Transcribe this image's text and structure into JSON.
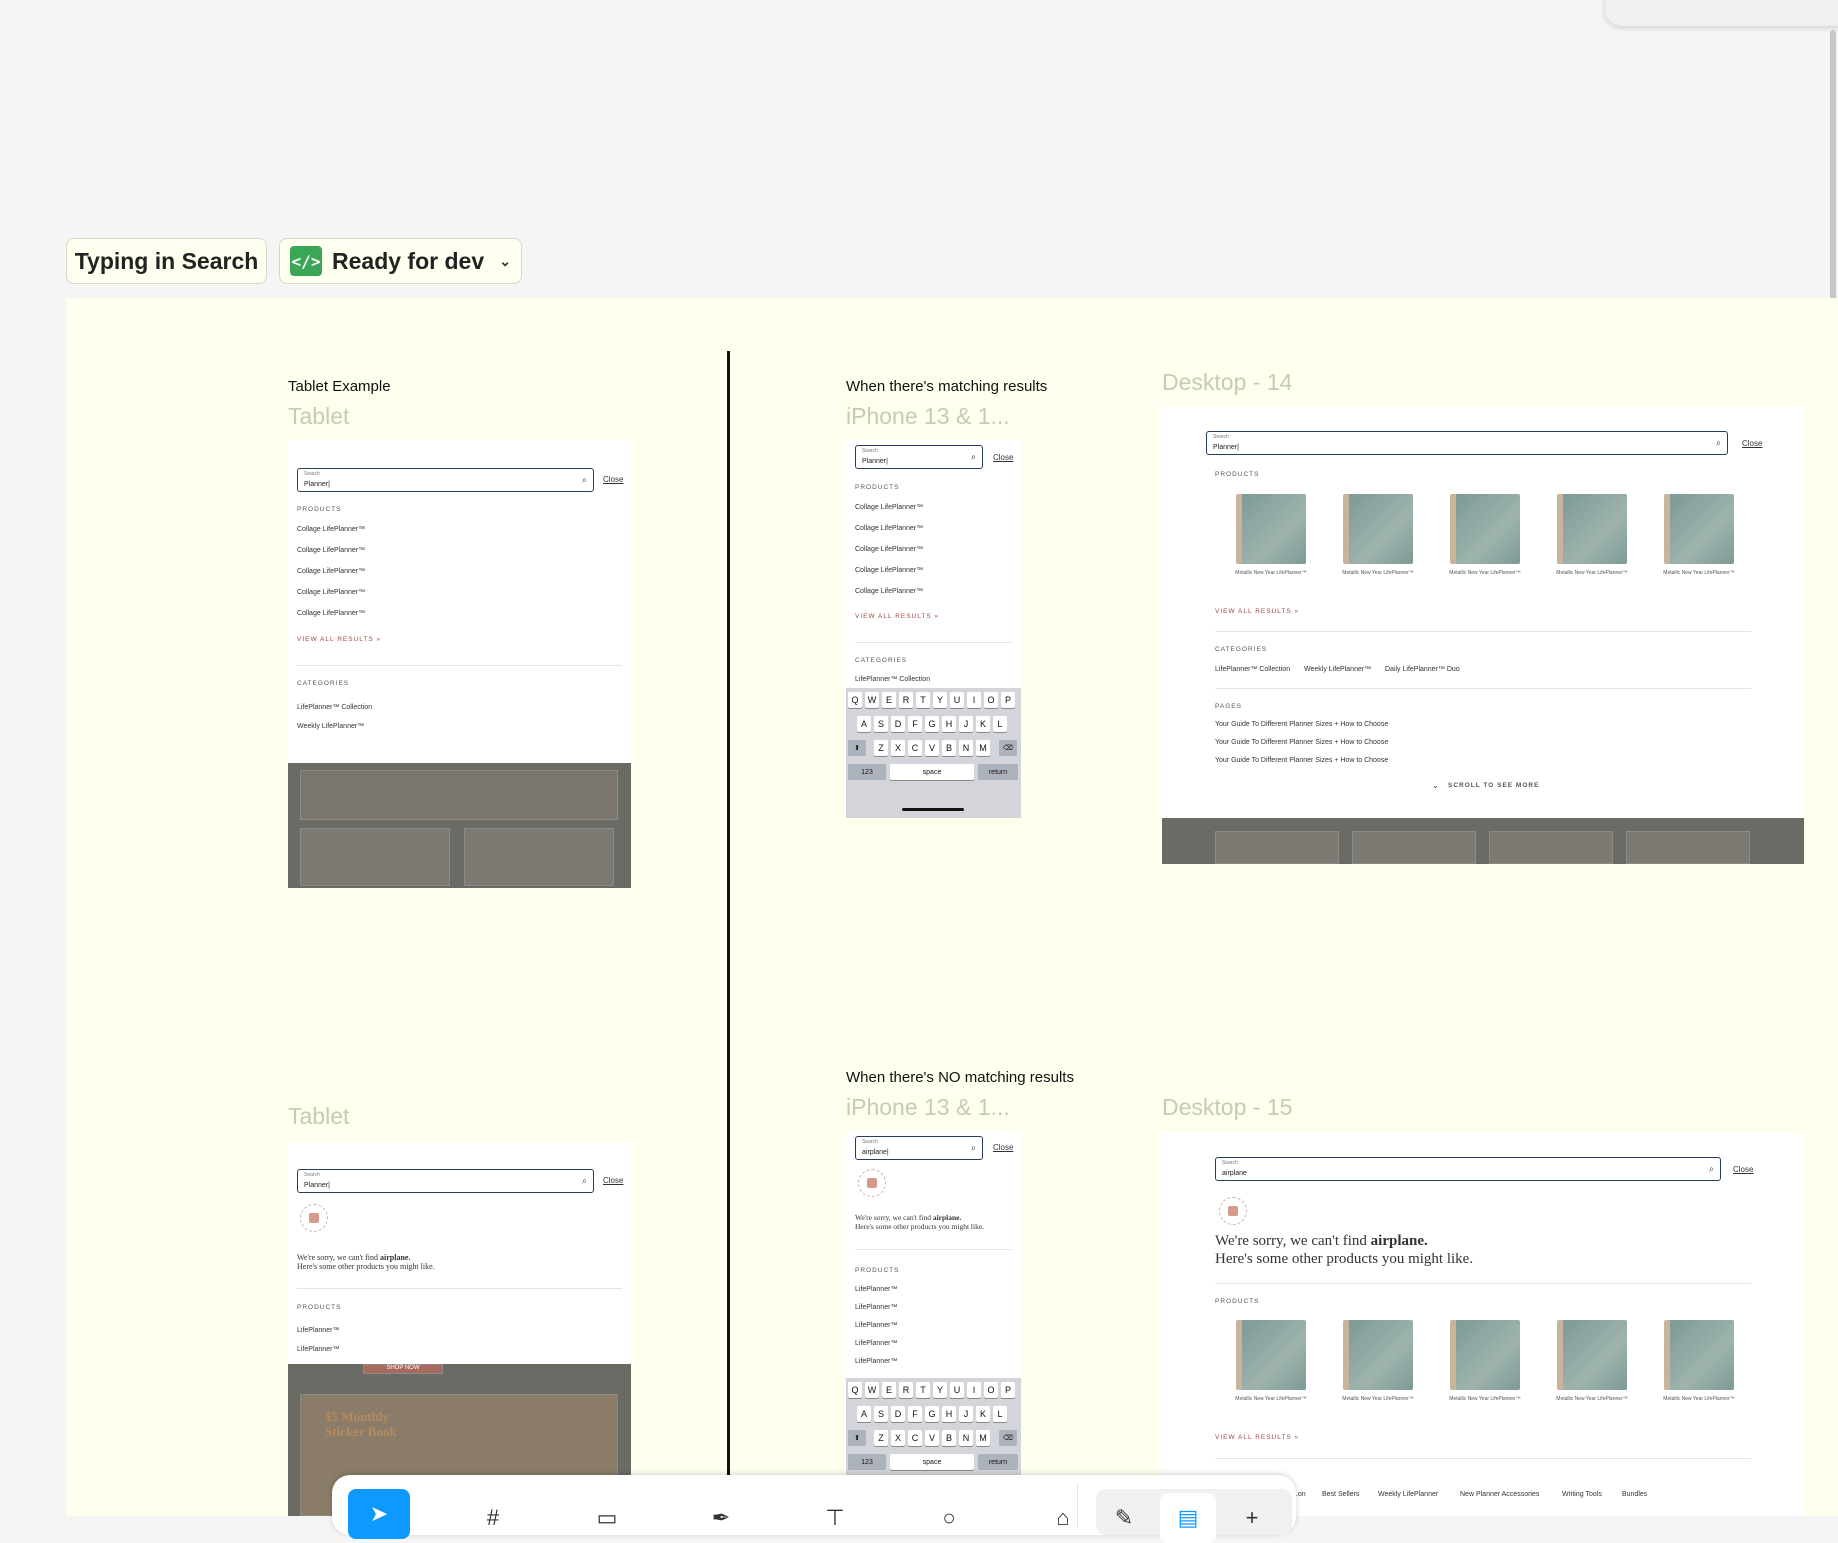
{
  "header": {
    "section_label": "Typing in Search",
    "status_label": "Ready for dev",
    "status_icon": "code-icon",
    "status_color": "#3aa757"
  },
  "frames": {
    "tablet_example": {
      "title": "Tablet Example",
      "label": "Tablet",
      "search_label": "Search",
      "search_value": "Planner|",
      "close": "Close",
      "products_heading": "PRODUCTS",
      "products": [
        "Collage LifePlanner™",
        "Collage LifePlanner™",
        "Collage LifePlanner™",
        "Collage LifePlanner™",
        "Collage LifePlanner™"
      ],
      "view_all": "VIEW ALL RESULTS »",
      "categories_heading": "CATEGORIES",
      "categories": [
        "LifePlanner™ Collection",
        "Weekly LifePlanner™"
      ]
    },
    "iphone_matching": {
      "title": "When there's matching results",
      "label": "iPhone 13 & 1...",
      "search_label": "Search",
      "search_value": "Planner|",
      "close": "Close",
      "products_heading": "PRODUCTS",
      "products": [
        "Collage LifePlanner™",
        "Collage LifePlanner™",
        "Collage LifePlanner™",
        "Collage LifePlanner™",
        "Collage LifePlanner™"
      ],
      "view_all": "VIEW ALL RESULTS »",
      "categories_heading": "CATEGORIES",
      "categories": [
        "LifePlanner™ Collection"
      ]
    },
    "desktop_14": {
      "label": "Desktop - 14",
      "search_label": "Search",
      "search_value": "Planner|",
      "close": "Close",
      "products_heading": "PRODUCTS",
      "product_captions": [
        "Metallic New Year LifePlanner™",
        "Metallic New Year LifePlanner™",
        "Metallic New Year LifePlanner™",
        "Metallic New Year LifePlanner™",
        "Metallic New Year LifePlanner™"
      ],
      "view_all": "VIEW ALL RESULTS »",
      "categories_heading": "CATEGORIES",
      "categories": [
        "LifePlanner™ Collection",
        "Weekly LifePlanner™",
        "Daily LifePlanner™ Duo"
      ],
      "pages_heading": "PAGES",
      "pages": [
        "Your Guide To Different Planner Sizes + How to Choose",
        "Your Guide To Different Planner Sizes + How to Choose",
        "Your Guide To Different Planner Sizes + How to Choose"
      ],
      "scroll_more": "SCROLL TO SEE MORE"
    },
    "tablet_no_match": {
      "label": "Tablet",
      "search_label": "Search",
      "search_value": "Planner|",
      "close": "Close",
      "sorry_line1_pre": "We're sorry, we can't find ",
      "sorry_term": "airplane.",
      "sorry_line2": "Here's some other products you might like.",
      "products_heading": "PRODUCTS",
      "products": [
        "LifePlanner™",
        "LifePlanner™"
      ],
      "promo_shop": "SHOP NOW",
      "promo_title": "$5 Monthly Sticker Book"
    },
    "iphone_no_match": {
      "title": "When there's NO matching results",
      "label": "iPhone 13 & 1...",
      "search_label": "Search",
      "search_value": "airplane|",
      "close": "Close",
      "sorry_line1_pre": "We're sorry, we can't find ",
      "sorry_term": "airplane.",
      "sorry_line2": "Here's some other products you might like.",
      "products_heading": "PRODUCTS",
      "products": [
        "LifePlanner™",
        "LifePlanner™",
        "LifePlanner™",
        "LifePlanner™",
        "LifePlanner™"
      ]
    },
    "desktop_15": {
      "label": "Desktop - 15",
      "search_label": "Search",
      "search_value": "airplane",
      "close": "Close",
      "sorry_line1_pre": "We're sorry, we can't find ",
      "sorry_term": "airplane.",
      "sorry_line2": "Here's some other products you might like.",
      "products_heading": "PRODUCTS",
      "product_captions": [
        "Metallic New Year LifePlanner™",
        "Metallic New Year LifePlanner™",
        "Metallic New Year LifePlanner™",
        "Metallic New Year LifePlanner™",
        "Metallic New Year LifePlanner™"
      ],
      "view_all": "VIEW ALL RESULTS »",
      "nav_links": [
        "...on",
        "Best Sellers",
        "Weekly LifePlanner",
        "New Planner Accessories",
        "Writing Tools",
        "Bundles"
      ]
    }
  },
  "keyboard": {
    "row1": [
      "Q",
      "W",
      "E",
      "R",
      "T",
      "Y",
      "U",
      "I",
      "O",
      "P"
    ],
    "row2": [
      "A",
      "S",
      "D",
      "F",
      "G",
      "H",
      "J",
      "K",
      "L"
    ],
    "row3": [
      "Z",
      "X",
      "C",
      "V",
      "B",
      "N",
      "M"
    ],
    "shift": "⬆",
    "delete": "⌫",
    "num": "123",
    "space": "space",
    "return": "return"
  },
  "toolbar": {
    "tools": [
      "move-tool-icon",
      "frame-tool-icon",
      "rectangle-tool-icon",
      "pen-tool-icon",
      "text-tool-icon",
      "comment-tool-icon",
      "shapes-tool-icon"
    ],
    "mode_tools": [
      "draw-mode-icon",
      "design-mode-icon",
      "more-icon"
    ]
  }
}
